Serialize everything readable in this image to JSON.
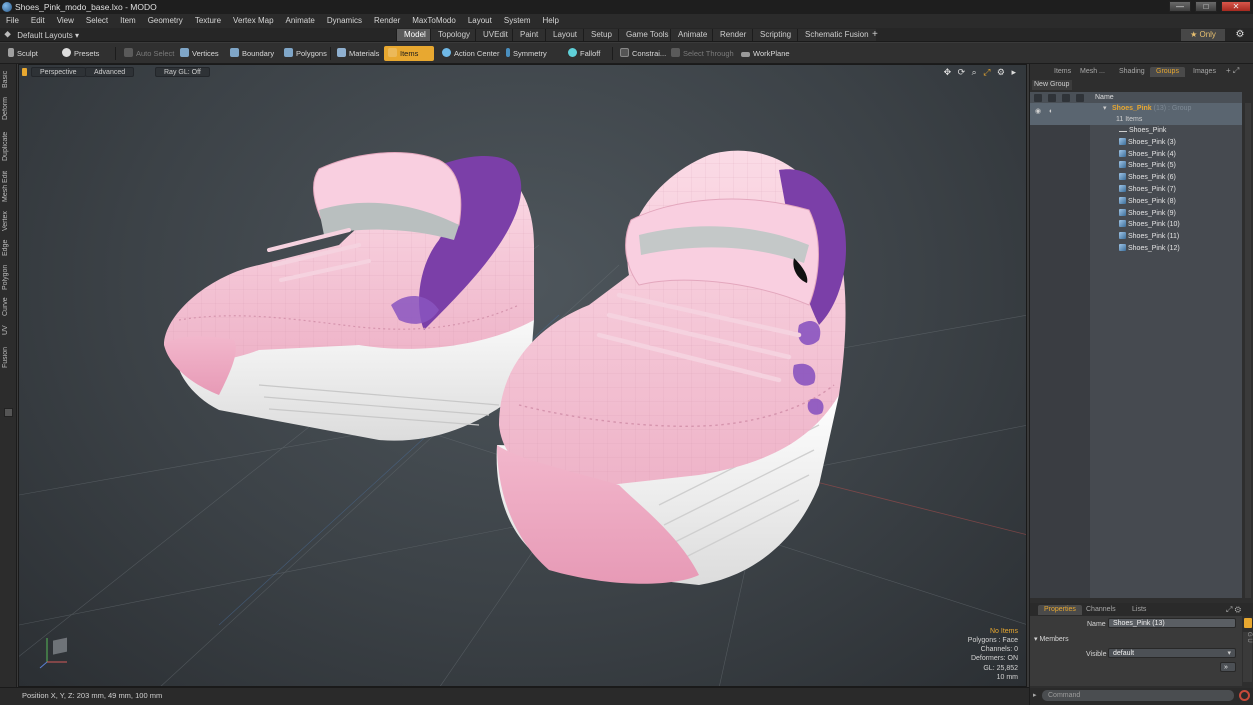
{
  "titlebar": {
    "title": "Shoes_Pink_modo_base.lxo - MODO"
  },
  "menu": [
    "File",
    "Edit",
    "View",
    "Select",
    "Item",
    "Geometry",
    "Texture",
    "Vertex Map",
    "Animate",
    "Dynamics",
    "Render",
    "MaxToModo",
    "Layout",
    "System",
    "Help"
  ],
  "layoutbar": {
    "layout_select": "Default Layouts ▾",
    "tabs": [
      "Model",
      "Topology",
      "UVEdit",
      "Paint",
      "Layout",
      "Setup",
      "Game Tools",
      "Animate",
      "Render",
      "Scripting",
      "Schematic Fusion"
    ],
    "active_tab": "Model",
    "add_tab": "+",
    "only_label": "★  Only"
  },
  "toolbar": {
    "sculpt": "Sculpt",
    "presets": "Presets",
    "auto_select": "Auto Select",
    "vertices": "Vertices",
    "boundary": "Boundary",
    "polygons": "Polygons",
    "materials": "Materials",
    "items": "Items",
    "action_center": "Action Center",
    "symmetry": "Symmetry",
    "falloff": "Falloff",
    "constraint": "Constrai...",
    "select_through": "Select Through",
    "workplane": "WorkPlane"
  },
  "left_tabs": [
    "Basic",
    "Deform",
    "Duplicate",
    "Mesh Edit",
    "Vertex",
    "Edge",
    "Polygon",
    "Curve",
    "UV",
    "Fusion"
  ],
  "viewport": {
    "perspective": "Perspective",
    "advanced": "Advanced",
    "raygl": "Ray GL: Off",
    "info": {
      "no_items": "No Items",
      "polygons": "Polygons : Face",
      "channels": "Channels: 0",
      "deformers": "Deformers: ON",
      "gl": "GL: 25,852",
      "unit": "10 mm"
    }
  },
  "statusbar": {
    "position": "Position X, Y, Z:   203 mm, 49 mm, 100 mm"
  },
  "rightpanel": {
    "tabs": [
      "Items",
      "Mesh ...",
      "Shading",
      "Groups",
      "Images"
    ],
    "active_tab": "Groups",
    "new_group": "New Group",
    "column_name": "Name",
    "group": {
      "name": "Shoes_Pink",
      "suffix": "(13) : Group",
      "count": "11 Items"
    },
    "items": [
      "Shoes_Pink",
      "Shoes_Pink (3)",
      "Shoes_Pink (4)",
      "Shoes_Pink (5)",
      "Shoes_Pink (6)",
      "Shoes_Pink (7)",
      "Shoes_Pink (8)",
      "Shoes_Pink (9)",
      "Shoes_Pink (10)",
      "Shoes_Pink (11)",
      "Shoes_Pink (12)"
    ],
    "props_tabs": [
      "Properties",
      "Channels",
      "Lists"
    ],
    "props_active": "Properties",
    "name_label": "Name",
    "name_value": "Shoes_Pink (13)",
    "members_label": "Members",
    "visible_label": "Visible",
    "visible_value": "default",
    "command_placeholder": "Command"
  },
  "colors": {
    "accent": "#e8a830",
    "selection": "#5a6570",
    "shoe_pink": "#f4c6d6",
    "shoe_purple": "#7a3fa8"
  }
}
